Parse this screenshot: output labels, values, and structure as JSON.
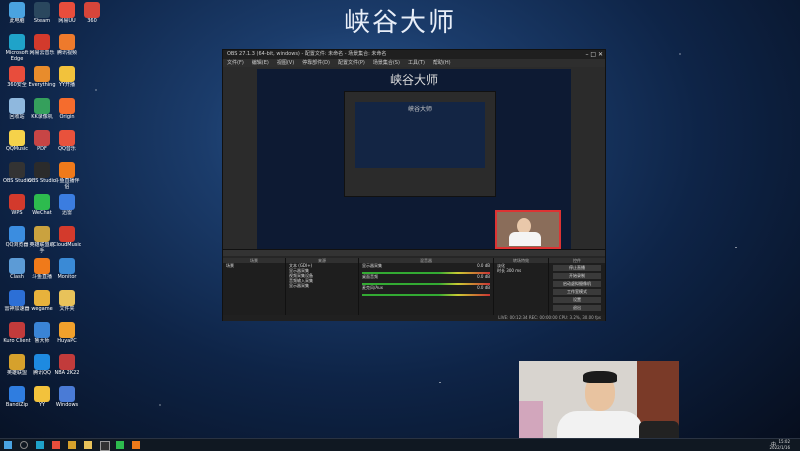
{
  "desktop": {
    "title": "峡谷大师",
    "icons": [
      {
        "label": "此电脑",
        "color": "#4aa3e0"
      },
      {
        "label": "Microsoft Edge",
        "color": "#1fa3c9"
      },
      {
        "label": "360安全",
        "color": "#e84d3c"
      },
      {
        "label": "回收站",
        "color": "#8fb8de"
      },
      {
        "label": "QQMusic",
        "color": "#f6d24a"
      },
      {
        "label": "OBS Studio",
        "color": "#333333"
      },
      {
        "label": "WPS",
        "color": "#d33a2c"
      },
      {
        "label": "QQ浏览器",
        "color": "#3b8de0"
      },
      {
        "label": "Clash",
        "color": "#5c9bd6"
      },
      {
        "label": "雷神加速器",
        "color": "#2c6fd6"
      },
      {
        "label": "Kuro Client",
        "color": "#c23b3b"
      },
      {
        "label": "英雄联盟",
        "color": "#d6a12c"
      },
      {
        "label": "BandiZip",
        "color": "#2f7de0"
      },
      {
        "label": "Steam",
        "color": "#2a475e"
      },
      {
        "label": "网易云音乐",
        "color": "#d33a2c"
      },
      {
        "label": "Everything",
        "color": "#e88c2c"
      },
      {
        "label": "KK录像机",
        "color": "#35a05c"
      },
      {
        "label": "PDF",
        "color": "#c74545"
      },
      {
        "label": "OBS Studio",
        "color": "#2b2b2b"
      },
      {
        "label": "WeChat",
        "color": "#2dbb4e"
      },
      {
        "label": "英雄联盟助手",
        "color": "#caa23f"
      },
      {
        "label": "斗鱼直播",
        "color": "#f07a1a"
      },
      {
        "label": "wegame",
        "color": "#e7b23c"
      },
      {
        "label": "鲁大师",
        "color": "#3a84d6"
      },
      {
        "label": "腾讯QQ",
        "color": "#1e8ae0"
      },
      {
        "label": "YY",
        "color": "#f2c23c"
      },
      {
        "label": "网易UU",
        "color": "#e84d3c"
      },
      {
        "label": "腾讯视频",
        "color": "#ee7a2c"
      },
      {
        "label": "YY开播",
        "color": "#f2c23c"
      },
      {
        "label": "Origin",
        "color": "#f56c2d"
      },
      {
        "label": "QQ音乐",
        "color": "#e8523c"
      },
      {
        "label": "斗鱼直播伴侣",
        "color": "#f07a1a"
      },
      {
        "label": "迅雷",
        "color": "#3b7de0"
      },
      {
        "label": "CloudMusic",
        "color": "#d33a2c"
      },
      {
        "label": "Monitor",
        "color": "#3a8ad6"
      },
      {
        "label": "文件夹",
        "color": "#e8c25a"
      },
      {
        "label": "HuyaPC",
        "color": "#f2a12c"
      },
      {
        "label": "NBA 2K22",
        "color": "#c23b3b"
      },
      {
        "label": "Windows",
        "color": "#4a7bd6"
      },
      {
        "label": "360",
        "color": "#d6453a"
      }
    ]
  },
  "obs": {
    "title": "OBS 27.1.3 (64-bit, windows) - 配置文件: 未命名 - 场景集合: 未命名",
    "menu": [
      "文件(F)",
      "编辑(E)",
      "视图(V)",
      "停靠部件(D)",
      "配置文件(P)",
      "场景集合(S)",
      "工具(T)",
      "帮助(H)"
    ],
    "preview_title": "峡谷大师",
    "nested_title": "峡谷大师",
    "dock_tabs": [
      "场景",
      "来源",
      "混音器",
      "转场特效",
      "控件"
    ],
    "scenes": [
      "场景"
    ],
    "sources": [
      "文本 (GDI+)",
      "显示器采集",
      "视频采集设备",
      "音频输入采集",
      "显示器采集"
    ],
    "mixer": [
      {
        "name": "显示器采集",
        "level": "0.0 dB"
      },
      {
        "name": "桌面音频",
        "level": "0.0 dB"
      },
      {
        "name": "麦克风/Aux",
        "level": "0.0 dB"
      }
    ],
    "transition": {
      "mode": "淡化",
      "duration_label": "时长",
      "duration": "300 ms"
    },
    "controls": [
      "停止直播",
      "开始录制",
      "启动虚拟摄像机",
      "工作室模式",
      "设置",
      "退出"
    ],
    "status": "LIVE: 00:12:34  REC: 00:00:00  CPU: 3.2%, 30.00 fps"
  },
  "taskbar": {
    "time": "15:02",
    "date": "2022/1/16",
    "lang": "中"
  }
}
